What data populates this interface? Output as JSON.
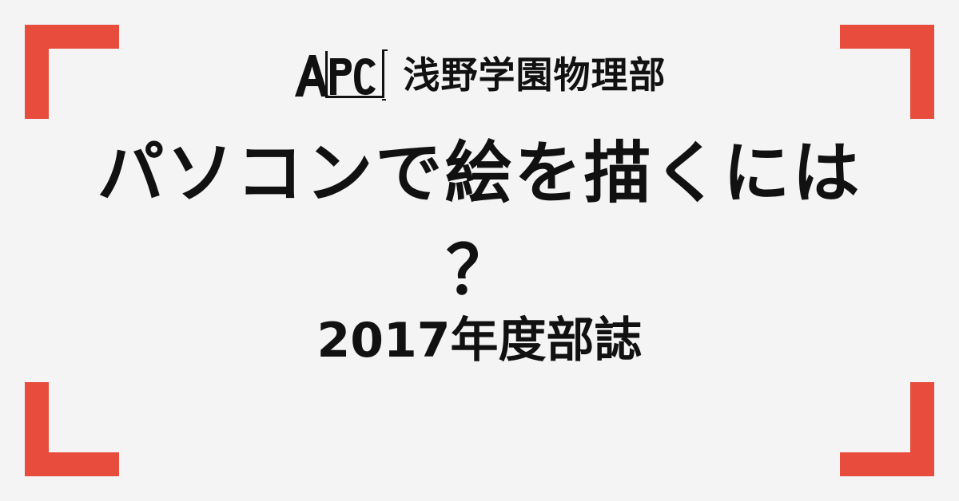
{
  "header": {
    "logo_text": "APC",
    "club_name": "浅野学園物理部"
  },
  "title": {
    "line1": "パソコンで絵を描くには",
    "line2": "？"
  },
  "subtitle": "2017年度部誌",
  "colors": {
    "accent": "#e84c3d",
    "background": "#f4f4f4",
    "text": "#111111"
  }
}
